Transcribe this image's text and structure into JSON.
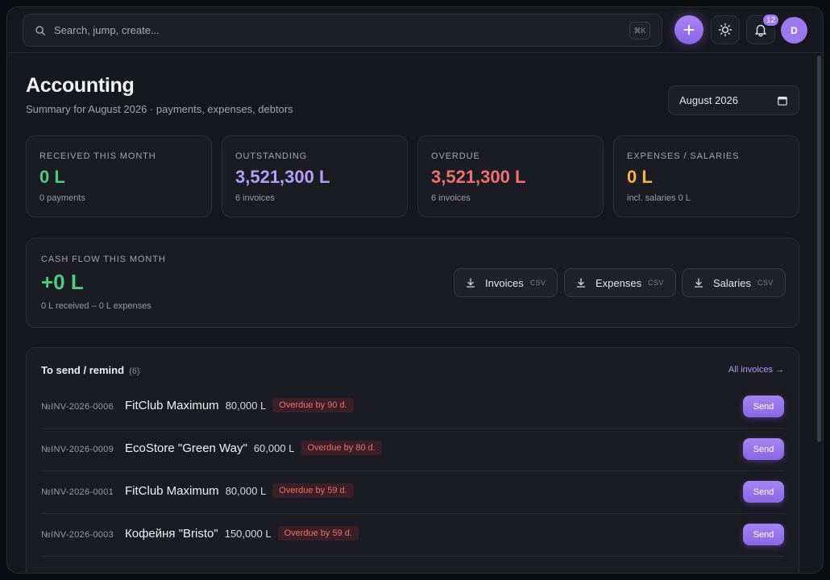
{
  "topbar": {
    "search_placeholder": "Search, jump, create...",
    "search_shortcut": "⌘K",
    "notifications_count": "12",
    "avatar_initial": "D"
  },
  "header": {
    "title": "Accounting",
    "subtitle": "Summary for August 2026 · payments, expenses, debtors",
    "month_value": "August 2026"
  },
  "stats": [
    {
      "label": "RECEIVED THIS MONTH",
      "value": "0 L",
      "sub": "0 payments",
      "color": "#4ecb7f"
    },
    {
      "label": "OUTSTANDING",
      "value": "3,521,300 L",
      "sub": "6 invoices",
      "color": "#b4a0f7"
    },
    {
      "label": "OVERDUE",
      "value": "3,521,300 L",
      "sub": "6 invoices",
      "color": "#f07070"
    },
    {
      "label": "EXPENSES / SALARIES",
      "value": "0 L",
      "sub": "incl. salaries 0 L",
      "color": "#f5b54a"
    }
  ],
  "cashflow": {
    "label": "CASH FLOW THIS MONTH",
    "value": "+0 L",
    "sub": "0 L received – 0 L expenses",
    "buttons": [
      {
        "label": "Invoices",
        "tag": "CSV"
      },
      {
        "label": "Expenses",
        "tag": "CSV"
      },
      {
        "label": "Salaries",
        "tag": "CSV"
      }
    ]
  },
  "remind": {
    "title": "To send / remind",
    "count": "(6)",
    "all_link": "All invoices →",
    "send_label": "Send",
    "rows": [
      {
        "number": "№INV-2026-0006",
        "client": "FitClub Maximum",
        "amount": "80,000 L",
        "overdue": "Overdue by 90 d."
      },
      {
        "number": "№INV-2026-0009",
        "client": "EcoStore \"Green Way\"",
        "amount": "60,000 L",
        "overdue": "Overdue by 80 d."
      },
      {
        "number": "№INV-2026-0001",
        "client": "FitClub Maximum",
        "amount": "80,000 L",
        "overdue": "Overdue by 59 d."
      },
      {
        "number": "№INV-2026-0003",
        "client": "Кофейня \"Bristo\"",
        "amount": "150,000 L",
        "overdue": "Overdue by 59 d."
      }
    ]
  }
}
